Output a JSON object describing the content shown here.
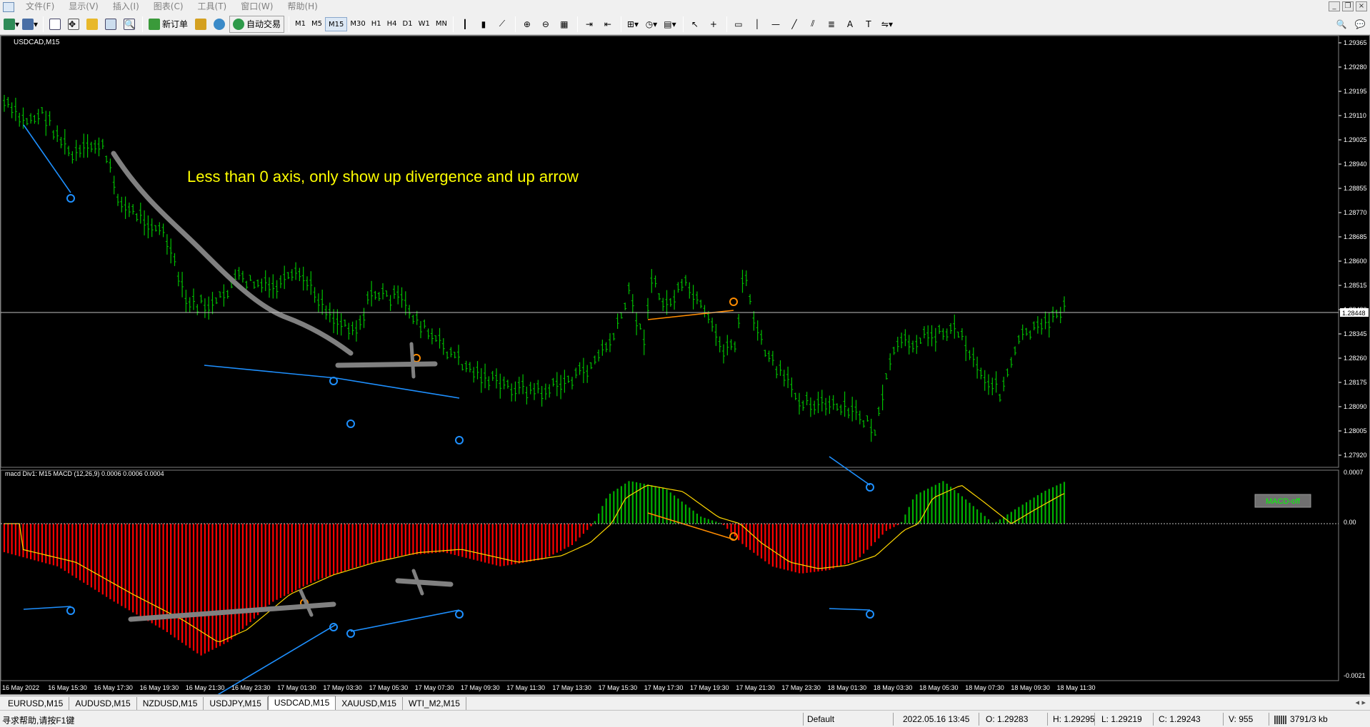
{
  "menu": [
    "文件(F)",
    "显示(V)",
    "插入(I)",
    "图表(C)",
    "工具(T)",
    "窗口(W)",
    "帮助(H)"
  ],
  "toolbar": {
    "new_order": "新订单",
    "auto_trading": "自动交易",
    "timeframes": [
      "M1",
      "M5",
      "M15",
      "M30",
      "H1",
      "H4",
      "D1",
      "W1",
      "MN"
    ],
    "active_timeframe": "M15"
  },
  "chart": {
    "symbol_label": "USDCAD,M15",
    "annotation": "Less than 0 axis, only show up divergence and up arrow",
    "price_axis": [
      "1.29365",
      "1.29280",
      "1.29195",
      "1.29110",
      "1.29025",
      "1.28940",
      "1.28855",
      "1.28770",
      "1.28685",
      "1.28600",
      "1.28515",
      "1.28430",
      "1.28345",
      "1.28260",
      "1.28175",
      "1.28090",
      "1.28005",
      "1.27920"
    ],
    "current_price": "1.28448",
    "indicator_label": "macd Div1: M15 MACD (12,26,9) 0.0006 0.0006 0.0004",
    "indicator_axis": [
      "0.0007",
      "0.00",
      "-0.0021"
    ],
    "macd_button": "MACD-off",
    "time_axis": [
      "16 May 2022",
      "16 May 15:30",
      "16 May 17:30",
      "16 May 19:30",
      "16 May 21:30",
      "16 May 23:30",
      "17 May 01:30",
      "17 May 03:30",
      "17 May 05:30",
      "17 May 07:30",
      "17 May 09:30",
      "17 May 11:30",
      "17 May 13:30",
      "17 May 15:30",
      "17 May 17:30",
      "17 May 19:30",
      "17 May 21:30",
      "17 May 23:30",
      "18 May 01:30",
      "18 May 03:30",
      "18 May 05:30",
      "18 May 07:30",
      "18 May 09:30",
      "18 May 11:30"
    ],
    "colors": {
      "bar": "#00c000",
      "hist_neg": "#ff0000",
      "hist_pos": "#00b000",
      "signal": "#ffd700",
      "bull_div": "#1e90ff",
      "bear_div": "#ff8c00",
      "annotation": "#ffff00"
    }
  },
  "tabs": [
    "EURUSD,M15",
    "AUDUSD,M15",
    "NZDUSD,M15",
    "USDJPY,M15",
    "USDCAD,M15",
    "XAUUSD,M15",
    "WTI_M2,M15"
  ],
  "active_tab": "USDCAD,M15",
  "status": {
    "help": "寻求帮助,请按F1键",
    "profile": "Default",
    "datetime": "2022.05.16 13:45",
    "open": "O: 1.29283",
    "high": "H: 1.29295",
    "low": "L: 1.29219",
    "close": "C: 1.29243",
    "volume": "V: 955",
    "traffic": "3791/3 kb"
  }
}
